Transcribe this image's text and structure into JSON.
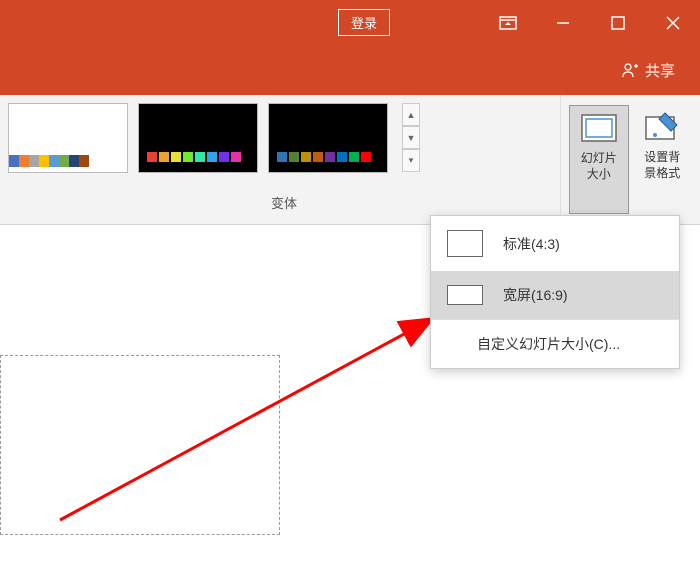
{
  "titlebar": {
    "signin": "登录"
  },
  "share": {
    "label": "共享"
  },
  "ribbon": {
    "variants_label": "变体",
    "slide_size_label": "幻灯片\n大小",
    "format_bg_label": "设置背\n景格式"
  },
  "dropdown": {
    "standard": "标准(4:3)",
    "widescreen": "宽屏(16:9)",
    "custom": "自定义幻灯片大小(C)..."
  },
  "colors": {
    "strip1": [
      "#4472c4",
      "#ed7d31",
      "#a5a5a5",
      "#ffc000",
      "#5b9bd5",
      "#70ad47",
      "#264478",
      "#9e480e"
    ],
    "strip2": [
      "#e84131",
      "#e8a331",
      "#e8e031",
      "#70e831",
      "#31e8a3",
      "#31a3e8",
      "#7031e8",
      "#e831a3"
    ],
    "strip3": [
      "#2e75b6",
      "#548235",
      "#bf9000",
      "#c55a11",
      "#7030a0",
      "#0070c0",
      "#00b050",
      "#ff0000"
    ]
  }
}
